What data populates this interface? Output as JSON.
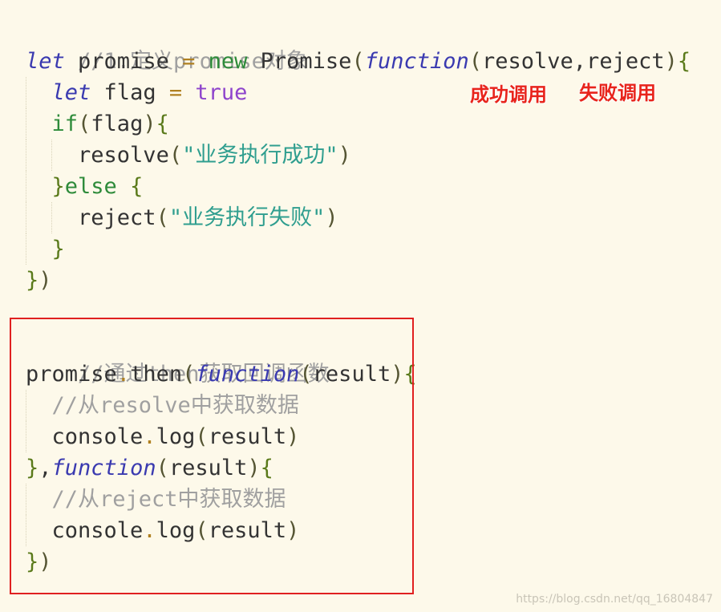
{
  "code": {
    "l1_comment": "//1.定义promise对象",
    "l2_let": "let",
    "l2_name": " promise ",
    "l2_eq": "=",
    "l2_new": " new",
    "l2_cls": " Promise",
    "l2_p1": "(",
    "l2_fn": "function",
    "l2_p2": "(",
    "l2_args": "resolve,reject",
    "l2_p3": ")",
    "l2_b": "{",
    "l3_let": "let",
    "l3_name": " flag ",
    "l3_eq": "=",
    "l3_true": " true",
    "l4_if": "if",
    "l4_p1": "(",
    "l4_arg": "flag",
    "l4_p2": ")",
    "l4_b": "{",
    "l5_call": "resolve",
    "l5_p1": "(",
    "l5_str": "\"业务执行成功\"",
    "l5_p2": ")",
    "l6_b1": "}",
    "l6_else": "else",
    "l6_b2": " {",
    "l7_call": "reject",
    "l7_p1": "(",
    "l7_str": "\"业务执行失败\"",
    "l7_p2": ")",
    "l8_b": "}",
    "l9_b": "}",
    "l9_p": ")",
    "l10_comment": "//通过then获取回调函数",
    "l11_obj": "promise",
    "l11_dot": ".",
    "l11_then": "then",
    "l11_p1": "(",
    "l11_fn": "function",
    "l11_p2": "(",
    "l11_arg": "result",
    "l11_p3": ")",
    "l11_b": "{",
    "l12_comment": "//从resolve中获取数据",
    "l13_obj": "console",
    "l13_dot": ".",
    "l13_log": "log",
    "l13_p1": "(",
    "l13_arg": "result",
    "l13_p2": ")",
    "l14_b": "}",
    "l14_comma": ",",
    "l14_fn": "function",
    "l14_p1": "(",
    "l14_arg": "result",
    "l14_p2": ")",
    "l14_b2": "{",
    "l15_comment": "//从reject中获取数据",
    "l16_obj": "console",
    "l16_dot": ".",
    "l16_log": "log",
    "l16_p1": "(",
    "l16_arg": "result",
    "l16_p2": ")",
    "l17_b": "}",
    "l17_p": ")"
  },
  "annotations": {
    "success": "成功调用",
    "failure": "失败调用"
  },
  "watermark": "https://blog.csdn.net/qq_16804847",
  "colors": {
    "background": "#fdf9ea",
    "highlight_box": "#e02020",
    "annotation": "#e8241c"
  }
}
